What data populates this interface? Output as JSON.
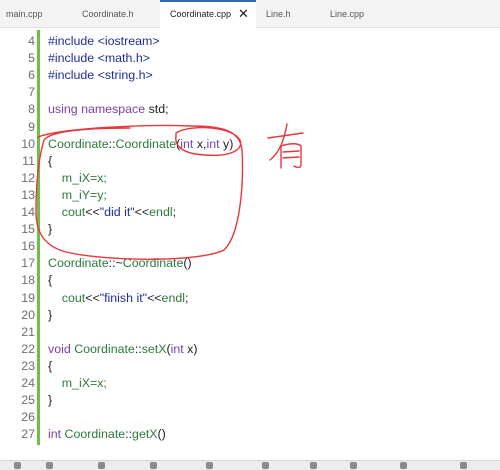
{
  "tabs": [
    {
      "label": "main.cpp",
      "active": false
    },
    {
      "label": "Coordinate.h",
      "active": false
    },
    {
      "label": "Coordinate.cpp",
      "active": true
    },
    {
      "label": "Line.h",
      "active": false
    },
    {
      "label": "Line.cpp",
      "active": false
    }
  ],
  "tab_close_glyph": "✕",
  "code_lines": [
    {
      "num": "4",
      "mark": "green",
      "tokens": [
        {
          "t": "#include ",
          "c": "tok-inc"
        },
        {
          "t": "<iostream>",
          "c": "tok-inc"
        }
      ]
    },
    {
      "num": "5",
      "mark": "green",
      "tokens": [
        {
          "t": "#include ",
          "c": "tok-inc"
        },
        {
          "t": "<math.h>",
          "c": "tok-inc"
        }
      ]
    },
    {
      "num": "6",
      "mark": "green",
      "tokens": [
        {
          "t": "#include ",
          "c": "tok-inc"
        },
        {
          "t": "<string.h>",
          "c": "tok-inc"
        }
      ]
    },
    {
      "num": "7",
      "mark": "green",
      "tokens": []
    },
    {
      "num": "8",
      "mark": "green",
      "tokens": [
        {
          "t": "using namespace ",
          "c": "tok-kw"
        },
        {
          "t": "std",
          "c": "tok-ns"
        },
        {
          "t": ";",
          "c": "tok-id"
        }
      ]
    },
    {
      "num": "9",
      "mark": "green",
      "tokens": []
    },
    {
      "num": "10",
      "mark": "green",
      "tokens": [
        {
          "t": "Coordinate",
          "c": "tok-type"
        },
        {
          "t": "::",
          "c": "tok-id"
        },
        {
          "t": "Coordinate",
          "c": "tok-type"
        },
        {
          "t": "(",
          "c": "tok-id"
        },
        {
          "t": "int ",
          "c": "tok-kw"
        },
        {
          "t": "x",
          "c": "tok-id"
        },
        {
          "t": ",",
          "c": "tok-id"
        },
        {
          "t": "int ",
          "c": "tok-kw"
        },
        {
          "t": "y",
          "c": "tok-id"
        },
        {
          "t": ")",
          "c": "tok-id"
        }
      ]
    },
    {
      "num": "11",
      "mark": "green",
      "tokens": [
        {
          "t": "{",
          "c": "tok-id"
        }
      ]
    },
    {
      "num": "12",
      "mark": "green",
      "tokens": [
        {
          "t": "    m_iX=x;",
          "c": "tok-type"
        }
      ]
    },
    {
      "num": "13",
      "mark": "green",
      "tokens": [
        {
          "t": "    m_iY=y;",
          "c": "tok-type"
        }
      ]
    },
    {
      "num": "14",
      "mark": "green",
      "tokens": [
        {
          "t": "    cout",
          "c": "tok-type"
        },
        {
          "t": "<<",
          "c": "tok-id"
        },
        {
          "t": "\"did it\"",
          "c": "tok-inc"
        },
        {
          "t": "<<",
          "c": "tok-id"
        },
        {
          "t": "endl",
          "c": "tok-type"
        },
        {
          "t": ";",
          "c": "tok-id"
        }
      ]
    },
    {
      "num": "15",
      "mark": "green",
      "tokens": [
        {
          "t": "}",
          "c": "tok-id"
        }
      ]
    },
    {
      "num": "16",
      "mark": "green",
      "tokens": []
    },
    {
      "num": "17",
      "mark": "green",
      "tokens": [
        {
          "t": "Coordinate",
          "c": "tok-type"
        },
        {
          "t": "::~",
          "c": "tok-id"
        },
        {
          "t": "Coordinate",
          "c": "tok-type"
        },
        {
          "t": "()",
          "c": "tok-id"
        }
      ]
    },
    {
      "num": "18",
      "mark": "green",
      "tokens": [
        {
          "t": "{",
          "c": "tok-id"
        }
      ]
    },
    {
      "num": "19",
      "mark": "green",
      "tokens": [
        {
          "t": "    cout",
          "c": "tok-type"
        },
        {
          "t": "<<",
          "c": "tok-id"
        },
        {
          "t": "\"finish it\"",
          "c": "tok-inc"
        },
        {
          "t": "<<",
          "c": "tok-id"
        },
        {
          "t": "endl",
          "c": "tok-type"
        },
        {
          "t": ";",
          "c": "tok-id"
        }
      ]
    },
    {
      "num": "20",
      "mark": "green",
      "tokens": [
        {
          "t": "}",
          "c": "tok-id"
        }
      ]
    },
    {
      "num": "21",
      "mark": "green",
      "tokens": []
    },
    {
      "num": "22",
      "mark": "green",
      "tokens": [
        {
          "t": "void ",
          "c": "tok-kw"
        },
        {
          "t": "Coordinate",
          "c": "tok-type"
        },
        {
          "t": "::",
          "c": "tok-id"
        },
        {
          "t": "setX",
          "c": "tok-type"
        },
        {
          "t": "(",
          "c": "tok-id"
        },
        {
          "t": "int ",
          "c": "tok-kw"
        },
        {
          "t": "x",
          "c": "tok-id"
        },
        {
          "t": ")",
          "c": "tok-id"
        }
      ]
    },
    {
      "num": "23",
      "mark": "green",
      "tokens": [
        {
          "t": "{",
          "c": "tok-id"
        }
      ]
    },
    {
      "num": "24",
      "mark": "green",
      "tokens": [
        {
          "t": "    m_iX=x;",
          "c": "tok-type"
        }
      ]
    },
    {
      "num": "25",
      "mark": "green",
      "tokens": [
        {
          "t": "}",
          "c": "tok-id"
        }
      ]
    },
    {
      "num": "26",
      "mark": "green",
      "tokens": []
    },
    {
      "num": "27",
      "mark": "green",
      "tokens": [
        {
          "t": "int ",
          "c": "tok-kw"
        },
        {
          "t": "Coordinate",
          "c": "tok-type"
        },
        {
          "t": "::",
          "c": "tok-id"
        },
        {
          "t": "getX",
          "c": "tok-type"
        },
        {
          "t": "()",
          "c": "tok-id"
        }
      ]
    }
  ],
  "annotation_text": "有",
  "colors": {
    "annotation": "#e8363b",
    "gutter_green": "#6cc04a",
    "active_tab_accent": "#2b6cb0"
  }
}
